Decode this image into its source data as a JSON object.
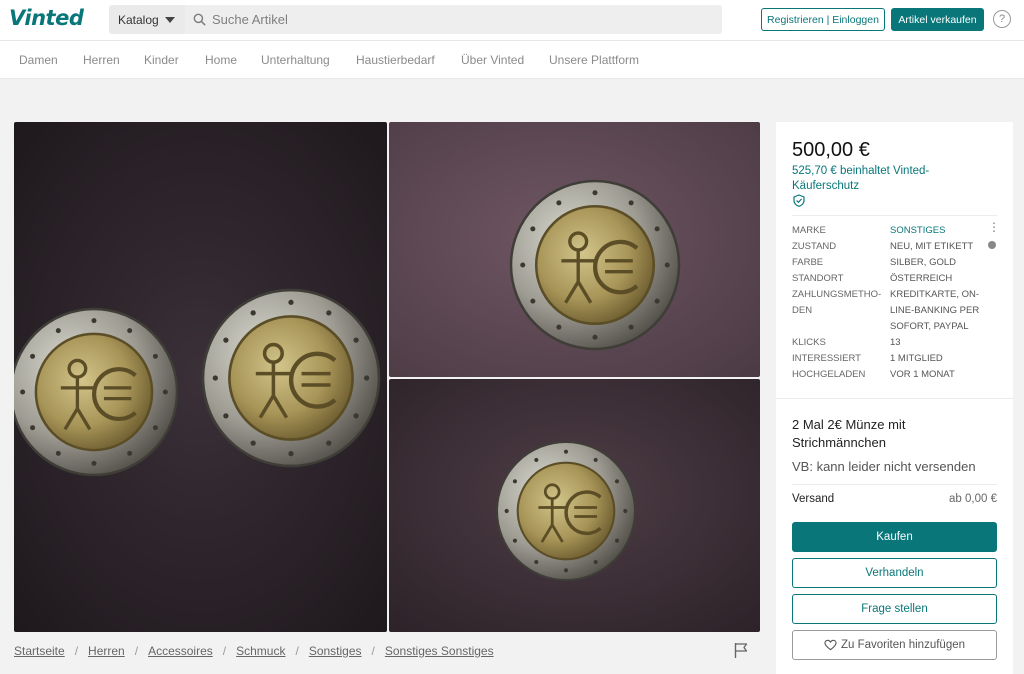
{
  "header": {
    "logo": "Vinted",
    "catalog_label": "Katalog",
    "search_placeholder": "Suche Artikel",
    "register_label": "Registrieren | Einloggen",
    "sell_label": "Artikel verkaufen",
    "help_symbol": "?"
  },
  "categories": [
    "Damen",
    "Herren",
    "Kinder",
    "Home",
    "Unterhaltung",
    "Haustierbedarf",
    "Über Vinted",
    "Unsere Plattform"
  ],
  "item": {
    "price": "500,00 €",
    "buyer_protection": "525,70 € beinhaltet Vinted-Käuferschutz",
    "details": [
      {
        "key": "MARKE",
        "value": "SONSTIGES"
      },
      {
        "key": "ZUSTAND",
        "value": "NEU, MIT ETIKETT"
      },
      {
        "key": "FARBE",
        "value": "SILBER, GOLD"
      },
      {
        "key": "STANDORT",
        "value": "ÖSTERREICH"
      },
      {
        "key": "ZAHLUNGSMETHO-DEN",
        "value": "KREDITKARTE, ON-LINE-BANKING PER SOFORT, PAYPAL"
      },
      {
        "key": "KLICKS",
        "value": "13"
      },
      {
        "key": "INTERESSIERT",
        "value": "1 MITGLIED"
      },
      {
        "key": "HOCHGELADEN",
        "value": "VOR 1 MONAT"
      }
    ],
    "title": "2 Mal 2€ Münze mit Strichmännchen",
    "description": "VB: kann leider nicht versenden",
    "shipping_label": "Versand",
    "shipping_value": "ab 0,00 €"
  },
  "actions": {
    "buy": "Kaufen",
    "negotiate": "Verhandeln",
    "ask": "Frage stellen",
    "favorite": "Zu Favoriten hinzufügen"
  },
  "breadcrumb": [
    "Startseite",
    "Herren",
    "Accessoires",
    "Schmuck",
    "Sonstiges",
    "Sonstiges Sonstiges"
  ],
  "colors": {
    "brand": "#09777a",
    "background": "#f2f2f2"
  },
  "icons": [
    "search-icon",
    "chevron-down-icon",
    "help-icon",
    "shield-icon",
    "flag-icon",
    "heart-icon",
    "more-icon",
    "info-icon"
  ]
}
